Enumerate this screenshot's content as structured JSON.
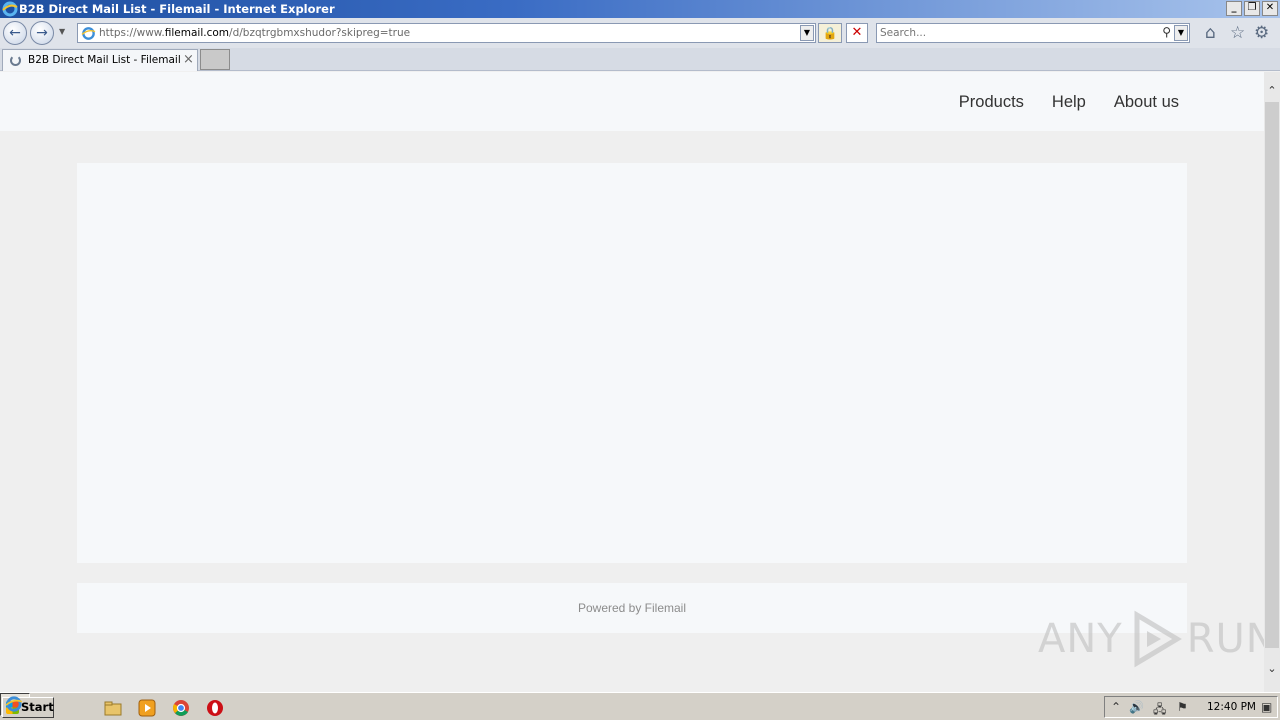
{
  "window": {
    "title": "B2B Direct Mail List - Filemail - Internet Explorer",
    "controls": [
      "_",
      "❐",
      "✕"
    ]
  },
  "address_bar": {
    "url_prefix": "https://www.",
    "url_host": "filemail.com",
    "url_path": "/d/bzqtrgbmxshudor?skipreg=true"
  },
  "search": {
    "placeholder": "Search..."
  },
  "tabs": [
    {
      "label": "B2B Direct Mail List - Filemail",
      "active": true
    }
  ],
  "site": {
    "nav": [
      {
        "label": "Products"
      },
      {
        "label": "Help"
      },
      {
        "label": "About us"
      }
    ],
    "footer_text": "Powered by Filemail"
  },
  "watermark": {
    "left": "ANY",
    "right": "RUN"
  },
  "taskbar": {
    "start_label": "Start",
    "clock": "12:40 PM"
  },
  "colors": {
    "titlebar_start": "#1e4fa0",
    "page_background": "#efefef",
    "card_background": "#f6f8fa",
    "nav_text": "#333333",
    "footer_text": "#8c8c8c"
  }
}
